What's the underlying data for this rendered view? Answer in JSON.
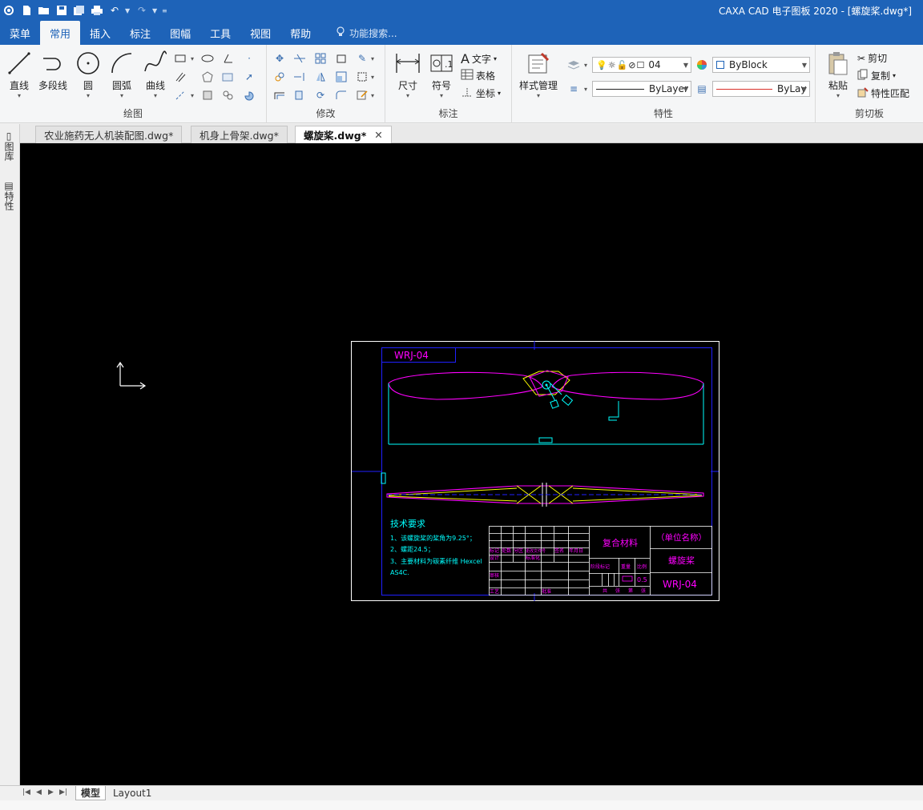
{
  "window_title": "CAXA CAD 电子图板 2020 - [螺旋桨.dwg*]",
  "ribbon_tabs": [
    "菜单",
    "常用",
    "插入",
    "标注",
    "图幅",
    "工具",
    "视图",
    "帮助"
  ],
  "function_search": "功能搜索...",
  "groups": {
    "draw": {
      "label": "绘图",
      "line": "直线",
      "polyline": "多段线",
      "circle": "圆",
      "arc": "圆弧",
      "curve": "曲线"
    },
    "modify": {
      "label": "修改"
    },
    "annotate": {
      "label": "标注",
      "dimension": "尺寸",
      "symbol": "符号",
      "text": "文字",
      "table": "表格",
      "coordinate": "坐标"
    },
    "properties": {
      "label": "特性",
      "style_manager": "样式管理",
      "layer_value": "04",
      "color_value": "ByBlock",
      "linetype_value": "ByLayer",
      "lineweight_value": "ByLay"
    },
    "clipboard": {
      "label": "剪切板",
      "paste": "粘贴",
      "cut": "剪切",
      "copy": "复制",
      "match_props": "特性匹配"
    }
  },
  "doc_tabs": [
    {
      "label": "农业施药无人机装配图.dwg*"
    },
    {
      "label": "机身上骨架.dwg*"
    },
    {
      "label": "螺旋桨.dwg*"
    }
  ],
  "side_panel": {
    "library": "图库",
    "properties": "特性"
  },
  "drawing": {
    "code_top": "WRJ-04",
    "tech_title": "技术要求",
    "tech_lines": [
      "1、该螺旋桨的桨角为9.25°；",
      "2、螺距24.5；",
      "3、主要材料为碳素纤维 Hexcel",
      "AS4C."
    ],
    "material": "复合材料",
    "org_name": "（单位名称）",
    "part_name": "螺旋桨",
    "code_bottom": "WRJ-04",
    "tb_labels": [
      "标记",
      "处数",
      "分区",
      "更改文件号",
      "签名",
      "年月日",
      "设计",
      "标准化",
      "审核",
      "工艺",
      "批准",
      "阶段标记",
      "重量",
      "比例",
      "共",
      "张",
      "第",
      "张"
    ],
    "scale": "0.5"
  },
  "layout_tabs": [
    "模型",
    "Layout1"
  ],
  "colors": {
    "accent": "#1e63b8",
    "magenta": "#ff00ff",
    "cyan": "#00ffff",
    "yellow": "#ffff00",
    "blue": "#0000ff"
  }
}
